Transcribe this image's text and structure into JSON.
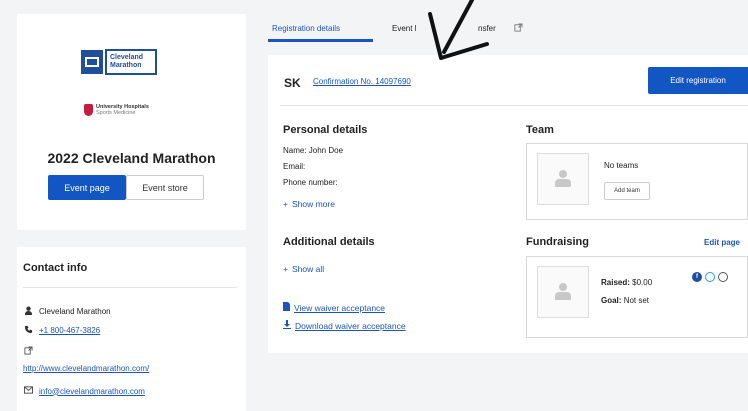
{
  "sidebar": {
    "logo_text_1": "Cleveland",
    "logo_text_2": "Marathon",
    "sponsor_line_1": "University Hospitals",
    "sponsor_line_2": "Sports Medicine",
    "event_title": "2022 Cleveland Marathon",
    "event_page_label": "Event page",
    "event_store_label": "Event store"
  },
  "contact": {
    "title": "Contact info",
    "name": "Cleveland Marathon",
    "phone": "+1 800-467-3826",
    "website": "http://www.clevelandmarathon.com/",
    "email": "info@clevelandmarathon.com"
  },
  "tabs": [
    {
      "label": "Registration details",
      "active": true
    },
    {
      "label": "Event l"
    },
    {
      "label": "nsfer"
    }
  ],
  "registration": {
    "initials": "SK",
    "confirmation": "Confirmation No. 14097690",
    "edit_label": "Edit registration"
  },
  "personal": {
    "title": "Personal details",
    "name_line": "Name: John Doe",
    "email_line": "Email:",
    "phone_line": "Phone number:",
    "show_more": "Show more"
  },
  "additional": {
    "title": "Additional details",
    "show_all": "Show all",
    "view_waiver": "View waiver acceptance",
    "download_waiver": "Download waiver acceptance"
  },
  "team": {
    "title": "Team",
    "no_teams": "No teams",
    "add_team": "Add team"
  },
  "fundraising": {
    "title": "Fundraising",
    "edit_link": "Edit page",
    "raised_label": "Raised:",
    "raised_value": "$0.00",
    "goal_label": "Goal:",
    "goal_value": "Not set"
  },
  "colors": {
    "primary": "#1256c4",
    "link": "#1a55c2",
    "background": "#f3f4f6"
  }
}
